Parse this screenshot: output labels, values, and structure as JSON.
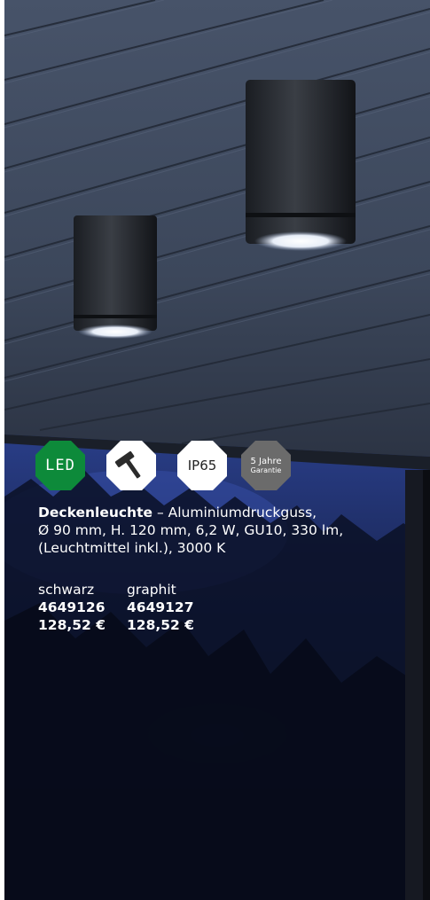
{
  "badges": {
    "led": "LED",
    "ip": "IP65",
    "warranty_line1": "5 Jahre",
    "warranty_line2": "Garantie",
    "colors": {
      "led": "#0d8a3a",
      "warranty": "#6b6b6b",
      "white": "#ffffff"
    }
  },
  "product": {
    "name": "Deckenleuchte",
    "separator": " – ",
    "desc_line1": "Aluminiumdruckguss,",
    "desc_line2": "Ø 90 mm, H. 120 mm, 6,2 W, GU10, 330 lm,",
    "desc_line3": "(Leuchtmittel inkl.), 3000 K",
    "variants": [
      {
        "color": "schwarz",
        "number": "4649126",
        "price": "128,52 €"
      },
      {
        "color": "graphit",
        "number": "4649127",
        "price": "128,52 €"
      }
    ]
  }
}
